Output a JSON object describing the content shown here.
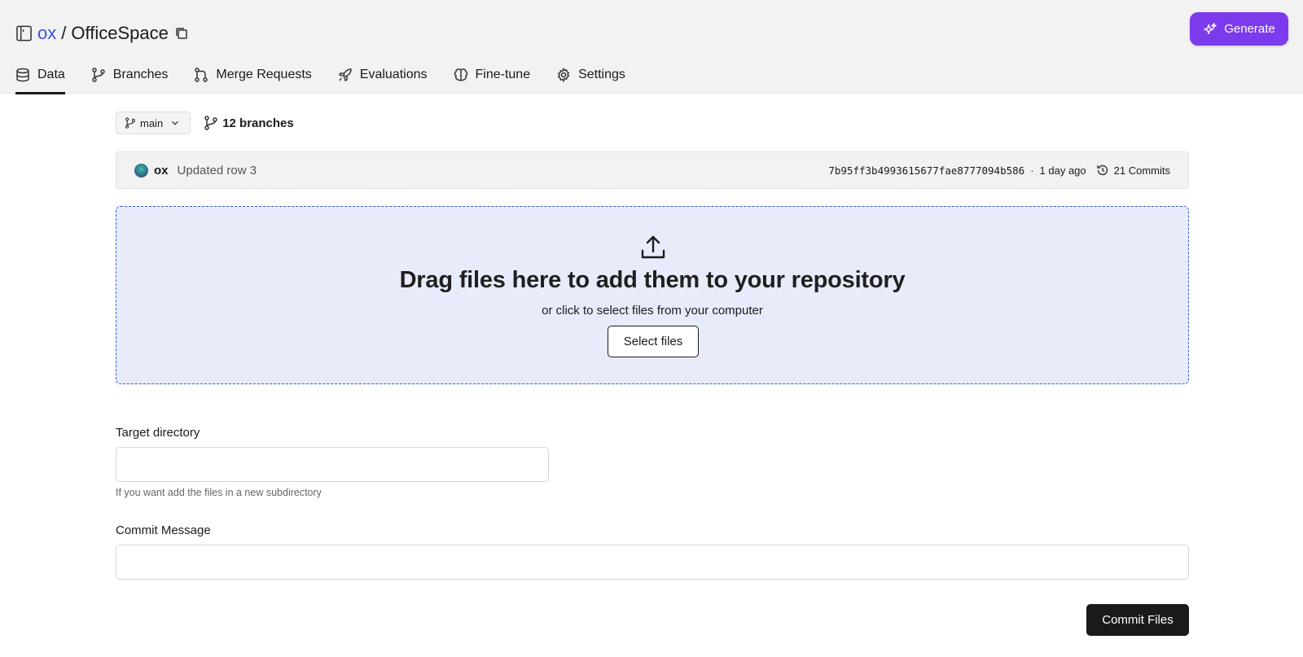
{
  "header": {
    "owner": "ox",
    "separator": "/",
    "repo_name": "OfficeSpace",
    "generate_label": "Generate",
    "accent_color": "#7c3aed",
    "link_color": "#3a53d9"
  },
  "tabs": [
    {
      "label": "Data",
      "icon": "database-icon",
      "active": true
    },
    {
      "label": "Branches",
      "icon": "git-branch-icon",
      "active": false
    },
    {
      "label": "Merge Requests",
      "icon": "git-merge-icon",
      "active": false
    },
    {
      "label": "Evaluations",
      "icon": "rocket-icon",
      "active": false
    },
    {
      "label": "Fine-tune",
      "icon": "brain-icon",
      "active": false
    },
    {
      "label": "Settings",
      "icon": "gear-icon",
      "active": false
    }
  ],
  "branch": {
    "current": "main",
    "count_label": "12 branches"
  },
  "commit": {
    "user": "ox",
    "message": "Updated row 3",
    "hash": "7b95ff3b4993615677fae8777094b586",
    "dot": "·",
    "time": "1 day ago",
    "commits_label": "21 Commits"
  },
  "dropzone": {
    "title": "Drag files here to add them to your repository",
    "subtitle": "or click to select files from your computer",
    "button_label": "Select files",
    "bg_color": "#e8ecfa",
    "border_color": "#3b5bd9"
  },
  "form": {
    "target_label": "Target directory",
    "target_value": "",
    "target_hint": "If you want add the files in a new subdirectory",
    "message_label": "Commit Message",
    "message_value": "",
    "submit_label": "Commit Files"
  }
}
